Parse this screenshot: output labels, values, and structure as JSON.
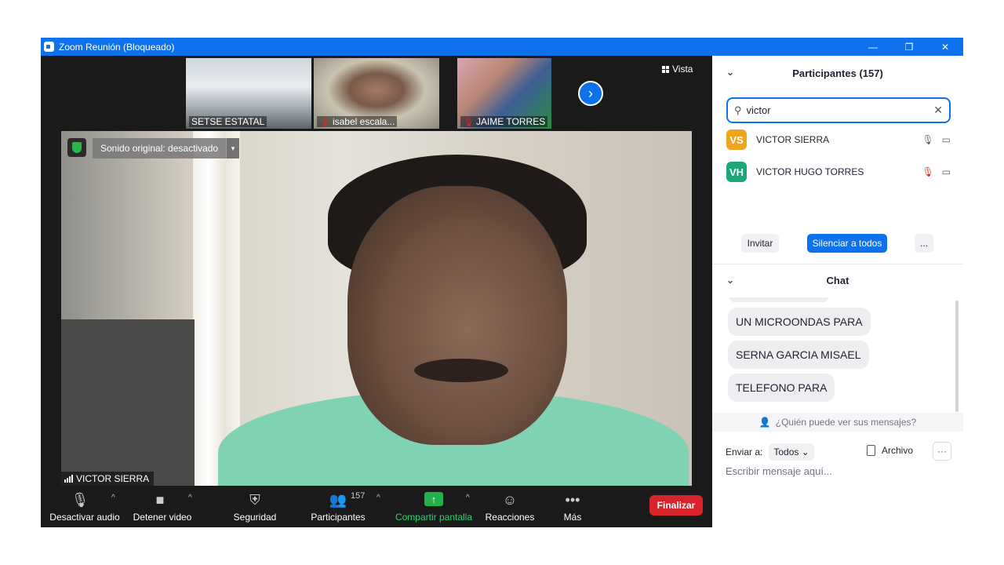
{
  "window": {
    "title": "Zoom Reunión (Bloqueado)",
    "controls": {
      "minimize": "—",
      "restore": "❐",
      "close": "✕"
    }
  },
  "gallery": {
    "thumbnails": [
      {
        "name": "SETSE ESTATAL",
        "muted": false
      },
      {
        "name": "isabel escala...",
        "muted": true
      },
      {
        "name": "JAIME TORRES",
        "muted": true
      }
    ],
    "next_icon": "›",
    "view_label": "Vista"
  },
  "main_video": {
    "speaker_name": "VICTOR SIERRA",
    "sound_label": "Sonido original: desactivado",
    "caret": "▾"
  },
  "toolbar": {
    "audio_label": "Desactivar audio",
    "video_label": "Detener video",
    "security_label": "Seguridad",
    "participants_label": "Participantes",
    "participants_count": "157",
    "share_label": "Compartir pantalla",
    "reactions_label": "Reacciones",
    "more_label": "Más",
    "end_label": "Finalizar",
    "caret": "^"
  },
  "participants_panel": {
    "title": "Participantes (157)",
    "search": {
      "value": "victor",
      "placeholder": ""
    },
    "items": [
      {
        "initials": "VS",
        "name": "VICTOR SIERRA",
        "color": "#f0a51f",
        "muted": false
      },
      {
        "initials": "VH",
        "name": "VICTOR HUGO TORRES",
        "color": "#1da678",
        "muted": true
      }
    ],
    "invite_label": "Invitar",
    "mute_all_label": "Silenciar a todos",
    "more_label": "..."
  },
  "chat": {
    "title": "Chat",
    "messages": [
      "UN MICROONDAS PARA",
      "SERNA GARCIA MISAEL",
      "TELEFONO PARA"
    ],
    "who_can_see": "¿Quién puede ver sus mensajes?",
    "send_to_label": "Enviar a:",
    "send_to_value": "Todos",
    "file_label": "Archivo",
    "more_label": "···",
    "input_placeholder": "Escribir mensaje aquí..."
  },
  "colors": {
    "accent": "#0e72ed",
    "end": "#d8232a",
    "share": "#23b14d",
    "mute_red": "#e02828"
  }
}
